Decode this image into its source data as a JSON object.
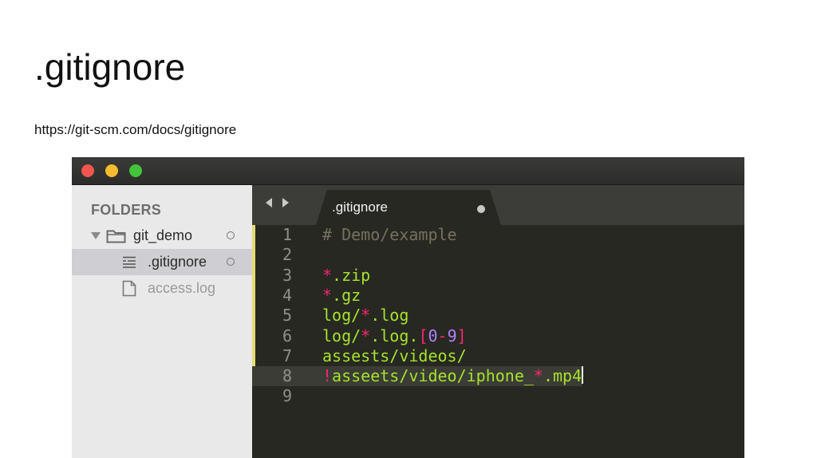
{
  "slide": {
    "title": ".gitignore",
    "link": "https://git-scm.com/docs/gitignore"
  },
  "sidebar": {
    "header": "FOLDERS",
    "items": [
      {
        "label": "git_demo",
        "icon": "folder-icon",
        "expanded": true
      },
      {
        "label": ".gitignore",
        "icon": "text-file-icon",
        "selected": true
      },
      {
        "label": "access.log",
        "icon": "file-icon"
      }
    ]
  },
  "tab": {
    "label": ".gitignore"
  },
  "editor": {
    "lines": [
      {
        "n": "1",
        "segments": [
          {
            "t": "# Demo/example",
            "k": "comment"
          }
        ]
      },
      {
        "n": "2",
        "segments": []
      },
      {
        "n": "3",
        "segments": [
          {
            "t": "*",
            "k": "op"
          },
          {
            "t": ".zip",
            "k": "text"
          }
        ]
      },
      {
        "n": "4",
        "segments": [
          {
            "t": "*",
            "k": "op"
          },
          {
            "t": ".gz",
            "k": "text"
          }
        ]
      },
      {
        "n": "5",
        "segments": [
          {
            "t": "log/",
            "k": "text"
          },
          {
            "t": "*",
            "k": "op"
          },
          {
            "t": ".log",
            "k": "text"
          }
        ]
      },
      {
        "n": "6",
        "segments": [
          {
            "t": "log/",
            "k": "text"
          },
          {
            "t": "*",
            "k": "op"
          },
          {
            "t": ".log.",
            "k": "text"
          },
          {
            "t": "[",
            "k": "op"
          },
          {
            "t": "0",
            "k": "num"
          },
          {
            "t": "-",
            "k": "op"
          },
          {
            "t": "9",
            "k": "num"
          },
          {
            "t": "]",
            "k": "op"
          }
        ]
      },
      {
        "n": "7",
        "segments": [
          {
            "t": "assests/videos/",
            "k": "text"
          }
        ]
      },
      {
        "n": "8",
        "segments": [
          {
            "t": "!",
            "k": "op"
          },
          {
            "t": "asseets/video/iphone_",
            "k": "text"
          },
          {
            "t": "*",
            "k": "op"
          },
          {
            "t": ".mp4",
            "k": "text"
          }
        ],
        "active": true
      },
      {
        "n": "9",
        "segments": []
      }
    ]
  },
  "colors": {
    "comment": "#75715e",
    "text": "#a6e22e",
    "operator": "#f92672",
    "number": "#ae81ff",
    "editor_bg": "#272822",
    "gutter_marker": "#e6db74"
  }
}
